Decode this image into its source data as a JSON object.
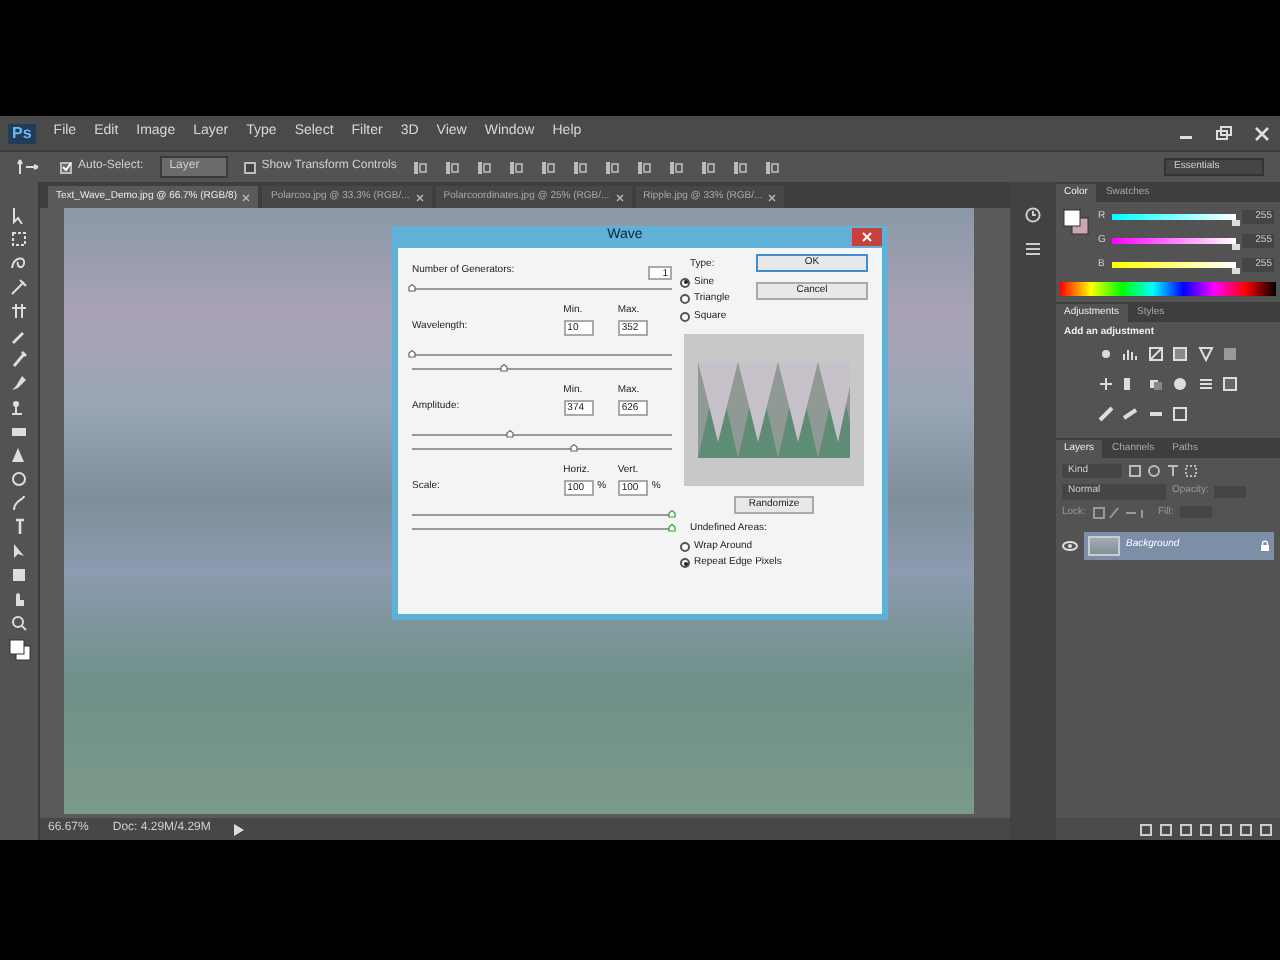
{
  "menu_bar": {
    "logo": "Ps",
    "items": [
      "File",
      "Edit",
      "Image",
      "Layer",
      "Type",
      "Select",
      "Filter",
      "3D",
      "View",
      "Window",
      "Help"
    ]
  },
  "options_bar": {
    "auto_select": {
      "label": "Auto-Select:",
      "checked": true
    },
    "target": "Layer",
    "show_transform": {
      "label": "Show Transform Controls",
      "checked": false
    },
    "workspace": "Essentials"
  },
  "tabs": [
    {
      "label": "Text_Wave_Demo.jpg @ 66.7% (RGB/8)",
      "selected": true
    },
    {
      "label": "Polarcoo.jpg @ 33.3% (RGB/...",
      "selected": false
    },
    {
      "label": "Polarcoordinates.jpg @ 25% (RGB/...",
      "selected": false
    },
    {
      "label": "Ripple.jpg @ 33% (RGB/...",
      "selected": false
    }
  ],
  "status_bar": {
    "zoom": "66.67%",
    "doc": "Doc: 4.29M/4.29M"
  },
  "dialog": {
    "title": "Wave",
    "generators": {
      "label": "Number of Generators:",
      "value": "1",
      "level": 0
    },
    "rows": [
      {
        "label": "Wavelength:",
        "headers": [
          "Min.",
          "Max."
        ],
        "values": [
          "10",
          "352"
        ],
        "sliders": [
          {
            "level": 0
          },
          {
            "level": 0.35
          }
        ]
      },
      {
        "label": "Amplitude:",
        "headers": [
          "Min.",
          "Max."
        ],
        "values": [
          "374",
          "626"
        ],
        "sliders": [
          {
            "level": 0.38
          },
          {
            "level": 0.62
          }
        ]
      },
      {
        "label": "Scale:",
        "headers": [
          "Horiz.",
          "Vert."
        ],
        "values": [
          "100",
          "100"
        ],
        "unit": "%",
        "sliders": [
          {
            "level": 1
          },
          {
            "level": 1
          }
        ]
      }
    ],
    "type": {
      "label": "Type:",
      "options": [
        {
          "label": "Sine",
          "selected": true
        },
        {
          "label": "Triangle",
          "selected": false
        },
        {
          "label": "Square",
          "selected": false
        }
      ]
    },
    "buttons": [
      "OK",
      "Cancel"
    ],
    "randomize": "Randomize",
    "undefined_areas": {
      "label": "Undefined Areas:",
      "options": [
        {
          "label": "Wrap Around",
          "selected": false
        },
        {
          "label": "Repeat Edge Pixels",
          "selected": true
        }
      ]
    }
  },
  "color_panel": {
    "tabs": [
      {
        "label": "Color",
        "selected": true
      },
      {
        "label": "Swatches",
        "selected": false
      }
    ],
    "channels": [
      {
        "name": "R",
        "level": 1,
        "reading": "255"
      },
      {
        "name": "G",
        "level": 1,
        "reading": "255"
      },
      {
        "name": "B",
        "level": 1,
        "reading": "255"
      }
    ]
  },
  "adjustments_panel": {
    "tabs": [
      {
        "label": "Adjustments",
        "selected": true
      },
      {
        "label": "Styles",
        "selected": false
      }
    ],
    "heading": "Add an adjustment"
  },
  "layers_panel": {
    "tabs": [
      {
        "label": "Layers",
        "selected": true
      },
      {
        "label": "Channels",
        "selected": false
      },
      {
        "label": "Paths",
        "selected": false
      }
    ],
    "filter": "Kind",
    "blend_mode": "Normal",
    "opacity_label": "Opacity:",
    "lock_label": "Lock:",
    "fill_label": "Fill:",
    "layers": [
      {
        "name": "Background",
        "visible": true,
        "locked": true
      }
    ]
  }
}
